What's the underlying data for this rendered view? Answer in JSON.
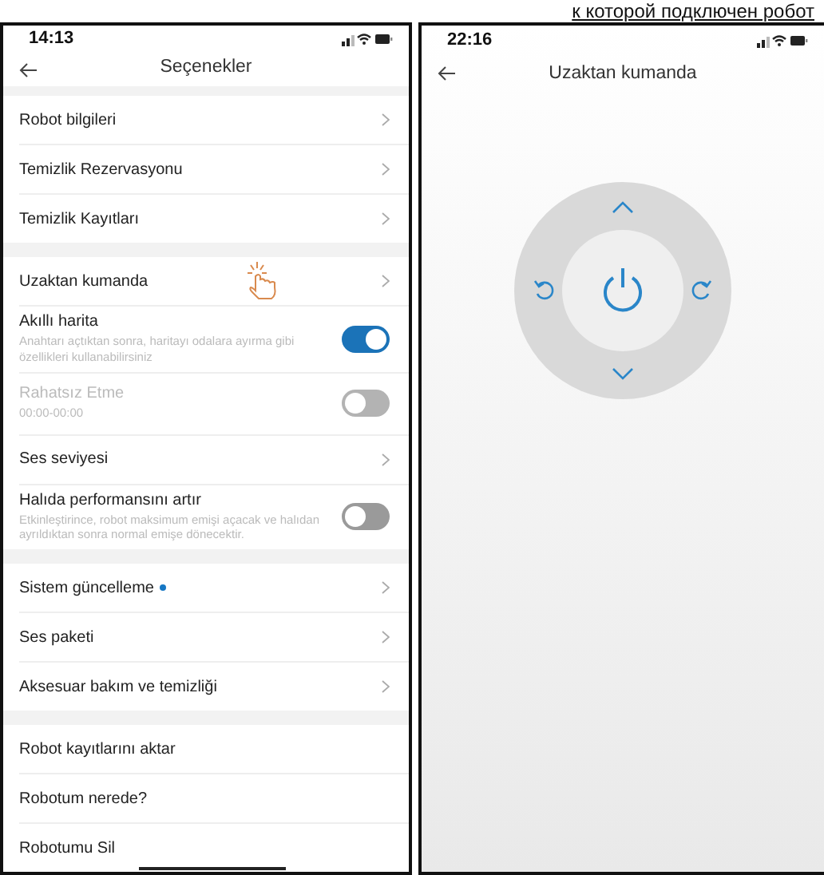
{
  "caption": "к которой подключен робот",
  "left_screen": {
    "status_bar": {
      "time": "14:13"
    },
    "title": "Seçenekler",
    "sections": [
      {
        "items": [
          {
            "kind": "link",
            "label": "Robot bilgileri"
          },
          {
            "kind": "link",
            "label": "Temizlik Rezervasyonu"
          },
          {
            "kind": "link",
            "label": "Temizlik Kayıtları"
          }
        ]
      },
      {
        "items": [
          {
            "kind": "link",
            "label": "Uzaktan kumanda",
            "tapped": true
          },
          {
            "kind": "toggle",
            "label": "Akıllı harita",
            "description": "Anahtarı açtıktan sonra, haritayı odalara ayırma gibi özellikleri kullanabilirsiniz",
            "on": true,
            "disabled": false
          },
          {
            "kind": "toggle",
            "label": "Rahatsız Etme",
            "description": "00:00-00:00",
            "on": false,
            "disabled": true
          },
          {
            "kind": "link",
            "label": "Ses seviyesi"
          },
          {
            "kind": "toggle",
            "label": "Halıda performansını artır",
            "description": "Etkinleştirince, robot maksimum emişi açacak ve halıdan ayrıldıktan sonra normal emişe dönecektir.",
            "on": false,
            "disabled": false
          }
        ]
      },
      {
        "items": [
          {
            "kind": "link",
            "label": "Sistem güncelleme",
            "badge": true
          },
          {
            "kind": "link",
            "label": "Ses paketi"
          },
          {
            "kind": "link",
            "label": "Aksesuar bakım ve temizliği"
          }
        ]
      },
      {
        "items": [
          {
            "kind": "action",
            "label": "Robot kayıtlarını aktar"
          },
          {
            "kind": "action",
            "label": "Robotum nerede?"
          },
          {
            "kind": "action",
            "label": "Robotumu Sil"
          }
        ]
      }
    ]
  },
  "right_screen": {
    "status_bar": {
      "time": "22:16"
    },
    "title": "Uzaktan kumanda"
  }
}
